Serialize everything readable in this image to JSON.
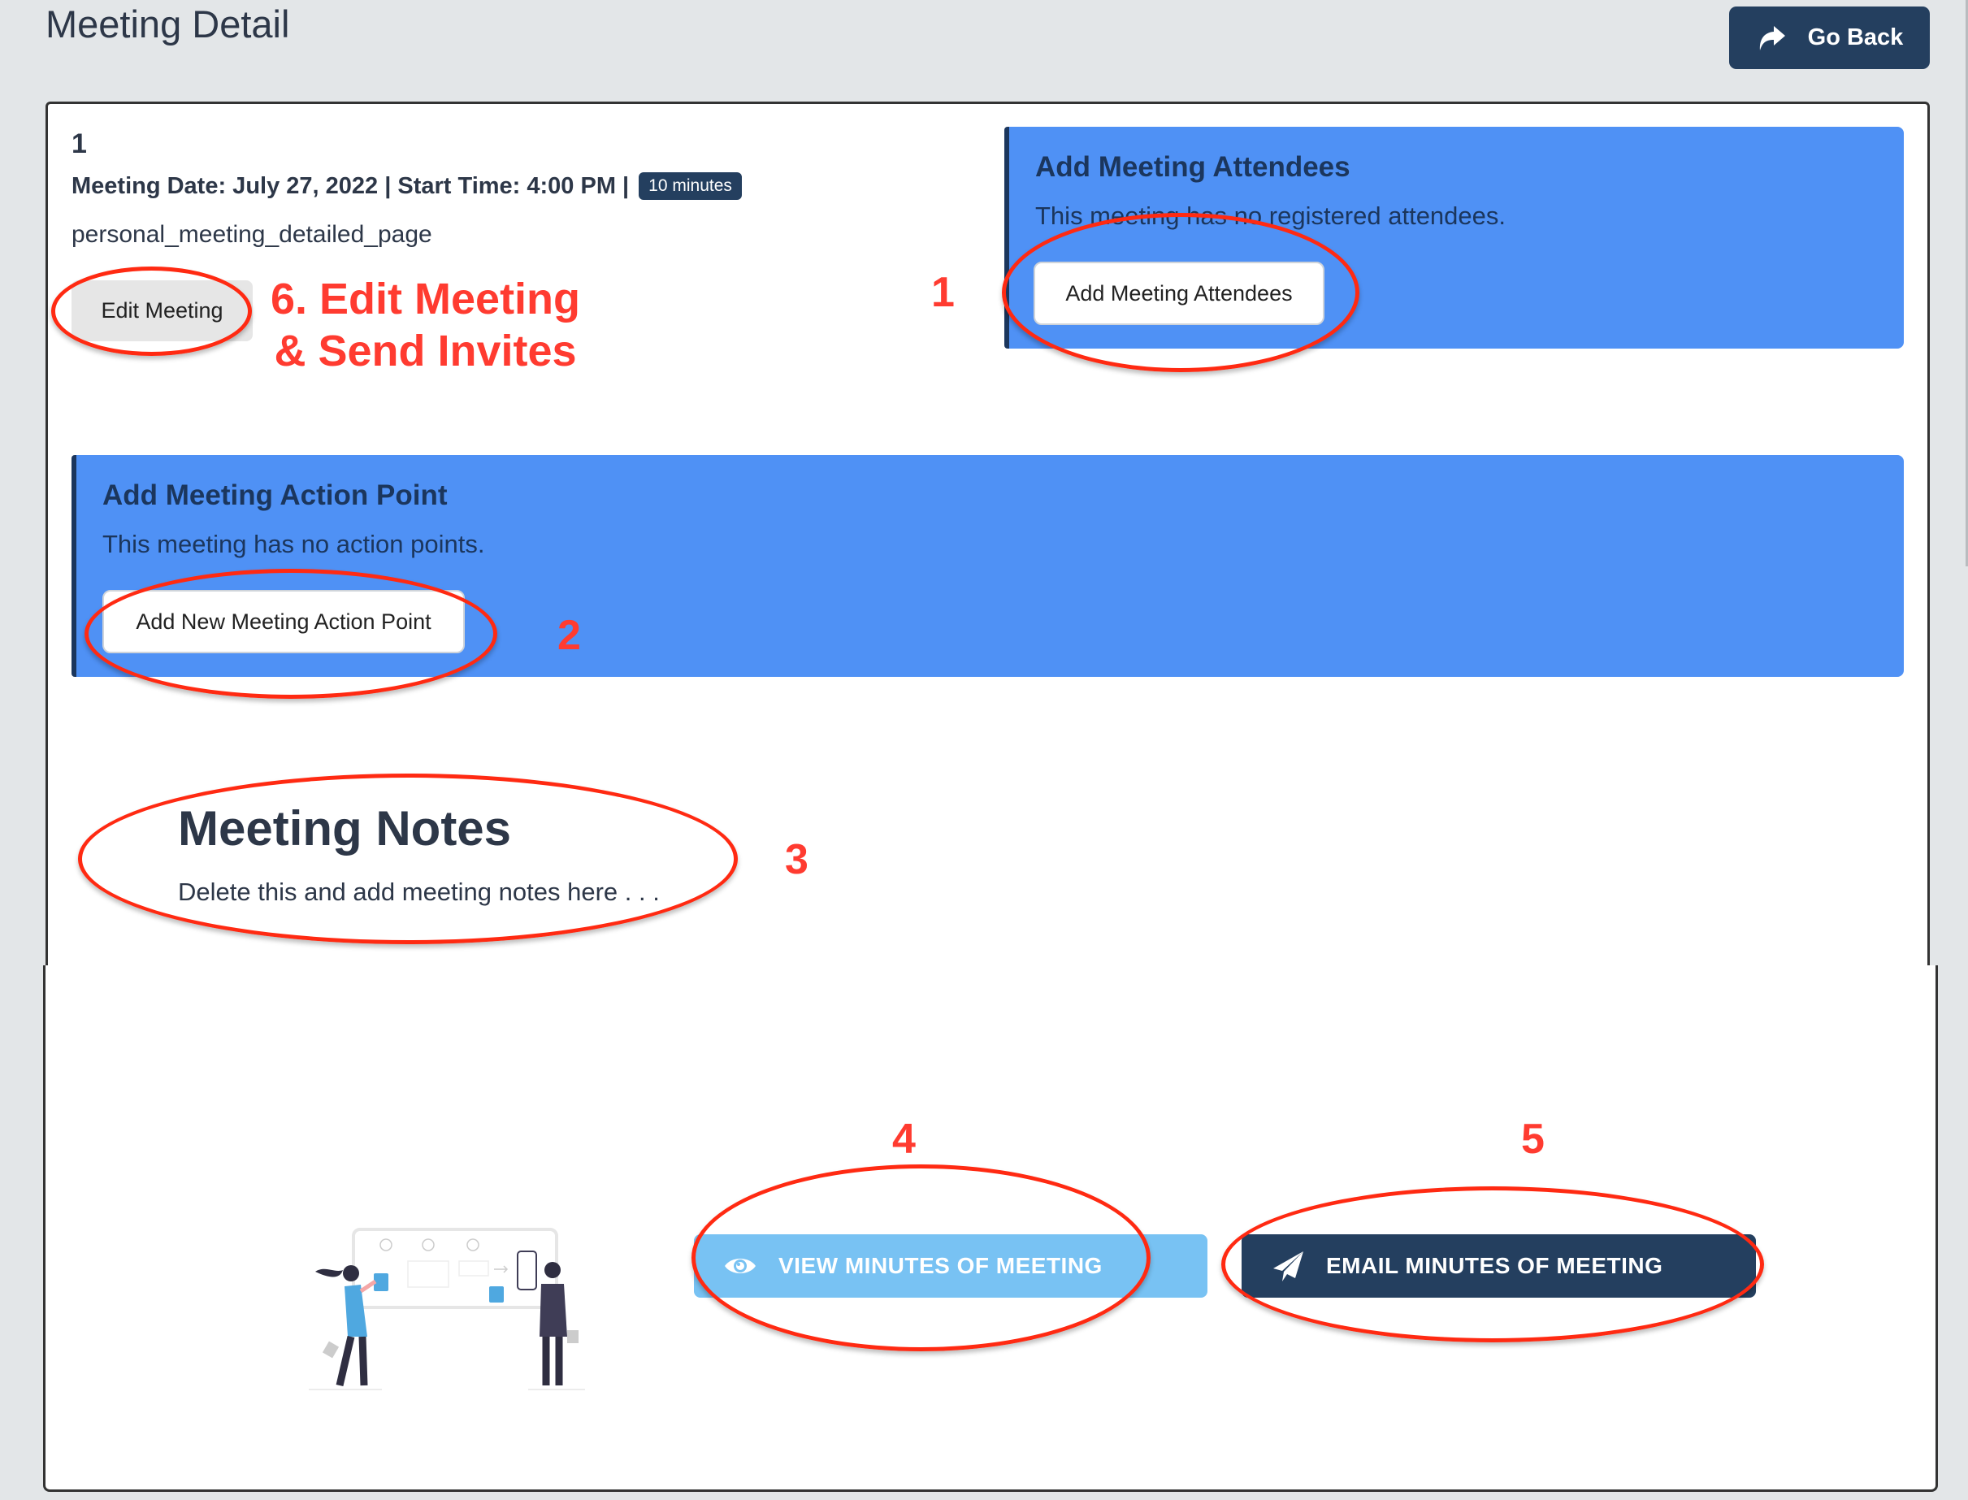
{
  "header": {
    "title": "Meeting Detail",
    "go_back_label": "Go Back",
    "go_back_icon": "share-arrow-icon"
  },
  "meeting": {
    "number": "1",
    "info": "Meeting Date: July 27, 2022 | Start Time: 4:00 PM |",
    "duration_badge": "10 minutes",
    "slug": "personal_meeting_detailed_page",
    "edit_button": "Edit Meeting"
  },
  "attendees_panel": {
    "title": "Add Meeting Attendees",
    "message": "This meeting has no registered attendees.",
    "button": "Add Meeting Attendees"
  },
  "action_points_panel": {
    "title": "Add Meeting Action Point",
    "message": "This meeting has no action points.",
    "button": "Add New Meeting Action Point"
  },
  "notes": {
    "title": "Meeting Notes",
    "text": "Delete this and add meeting notes here . . ."
  },
  "minutes_actions": {
    "view_label": "VIEW MINUTES OF MEETING",
    "view_icon": "eye-icon",
    "email_label": "EMAIL MINUTES OF MEETING",
    "email_icon": "paper-plane-icon"
  },
  "annotations": {
    "a1": "1",
    "a2": "2",
    "a3": "3",
    "a4": "4",
    "a5": "5",
    "a6_line1": "6. Edit Meeting",
    "a6_line2": "& Send Invites"
  },
  "colors": {
    "navy": "#243f5f",
    "panel_blue": "#4f91f5",
    "view_button_blue": "#78c2f3",
    "annotation_red": "#ff3b30"
  }
}
